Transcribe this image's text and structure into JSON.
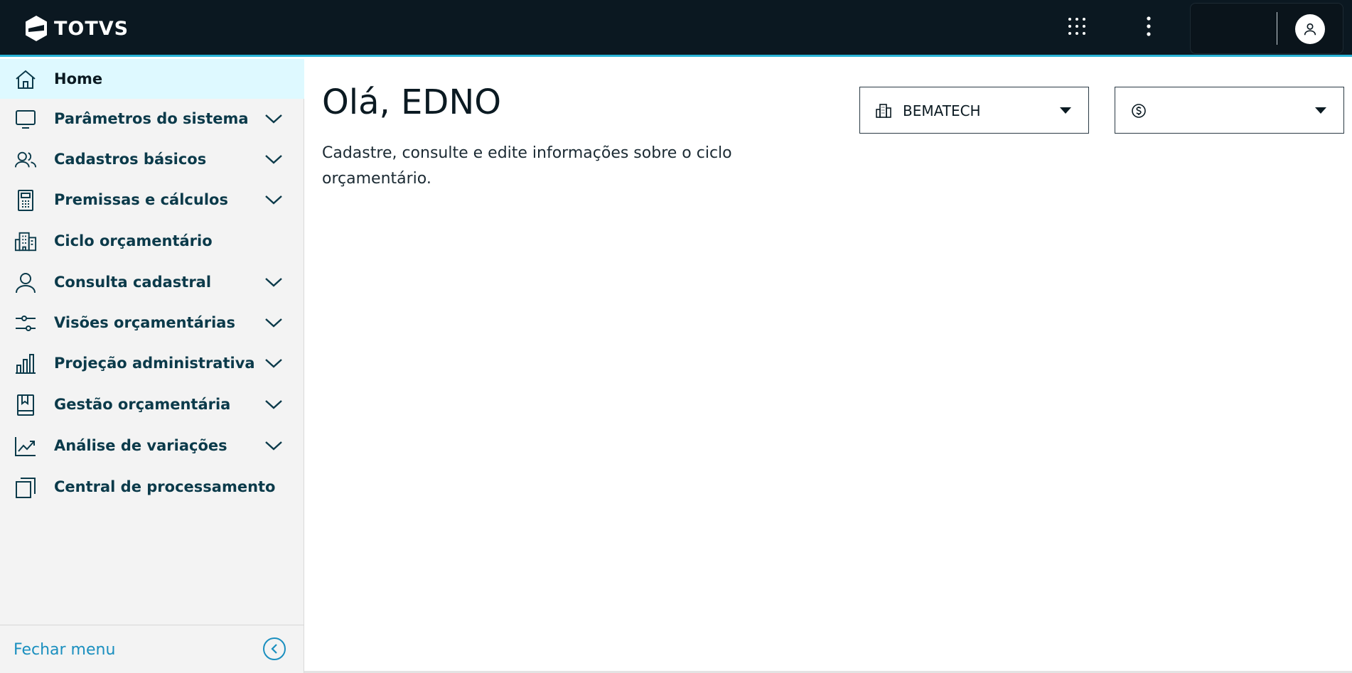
{
  "header": {
    "brand": "TOTVS",
    "apps_icon": "grid-apps-icon",
    "more_icon": "more-vertical-icon",
    "avatar_icon": "user-icon"
  },
  "sidebar": {
    "items": [
      {
        "label": "Home",
        "icon": "home-icon",
        "active": true,
        "expandable": false
      },
      {
        "label": "Parâmetros do sistema",
        "icon": "monitor-icon",
        "expandable": true
      },
      {
        "label": "Cadastros básicos",
        "icon": "users-icon",
        "expandable": true
      },
      {
        "label": "Premissas e cálculos",
        "icon": "calculator-icon",
        "expandable": true
      },
      {
        "label": "Ciclo orçamentário",
        "icon": "building-icon",
        "expandable": false
      },
      {
        "label": "Consulta cadastral",
        "icon": "user-icon",
        "expandable": true
      },
      {
        "label": "Visões orçamentárias",
        "icon": "sliders-icon",
        "expandable": true
      },
      {
        "label": "Projeção administrativa",
        "icon": "bar-chart-icon",
        "expandable": true
      },
      {
        "label": "Gestão orçamentária",
        "icon": "book-icon",
        "expandable": true
      },
      {
        "label": "Análise de variações",
        "icon": "trend-icon",
        "expandable": true
      },
      {
        "label": "Central de processamento",
        "icon": "copy-icon",
        "expandable": false
      }
    ],
    "close_label": "Fechar menu"
  },
  "main": {
    "greeting": "Olá, EDNO",
    "subtitle": "Cadastre, consulte e edite informações sobre o ciclo orçamentário.",
    "company_select": {
      "value": "BEMATECH",
      "icon": "building-icon"
    },
    "currency_select": {
      "value": "",
      "icon": "currency-icon"
    }
  },
  "colors": {
    "header_bg": "#0b1821",
    "accent": "#2ab3d6",
    "active_item_bg": "#def9ff",
    "link": "#1a8fbf"
  }
}
